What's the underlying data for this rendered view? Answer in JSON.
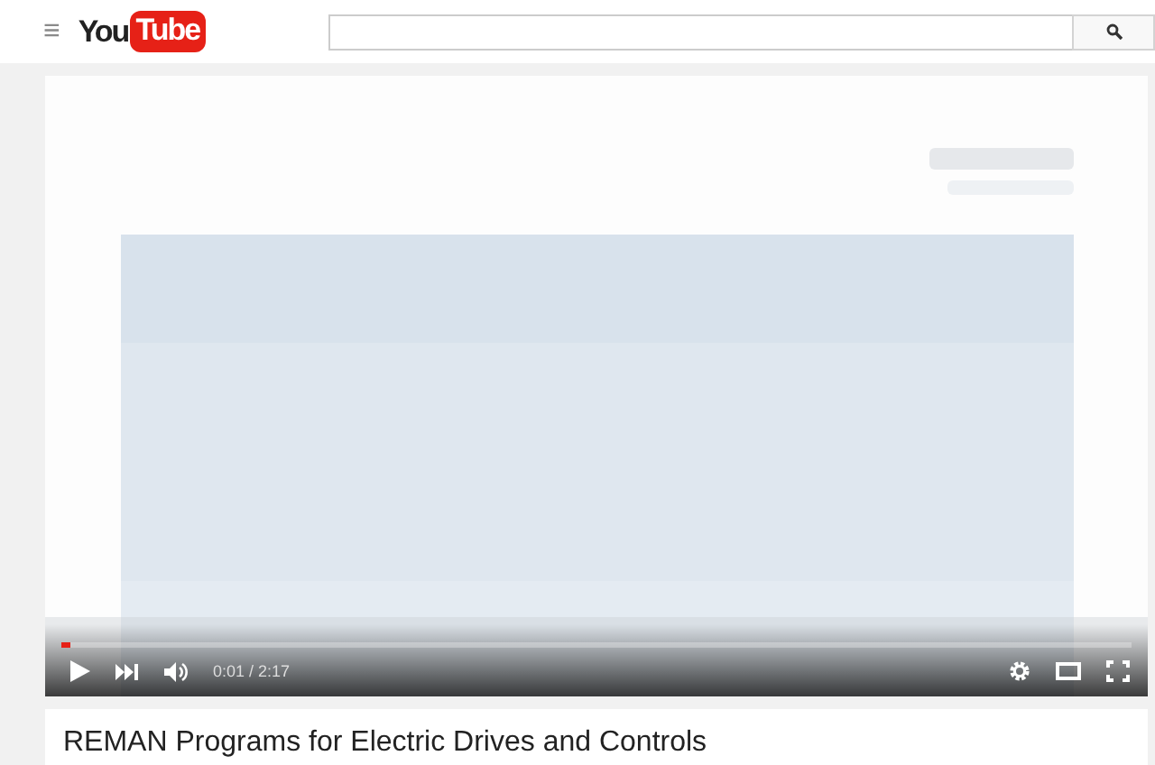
{
  "header": {
    "menu_icon": "≡",
    "logo": {
      "left": "You",
      "right": "Tube"
    }
  },
  "player": {
    "progress": {
      "level": 0.008
    },
    "time": {
      "current": "0:01",
      "separator": " / ",
      "duration": "2:17"
    },
    "playing": false
  },
  "video": {
    "title": "REMAN Programs for Electric Drives and Controls"
  }
}
